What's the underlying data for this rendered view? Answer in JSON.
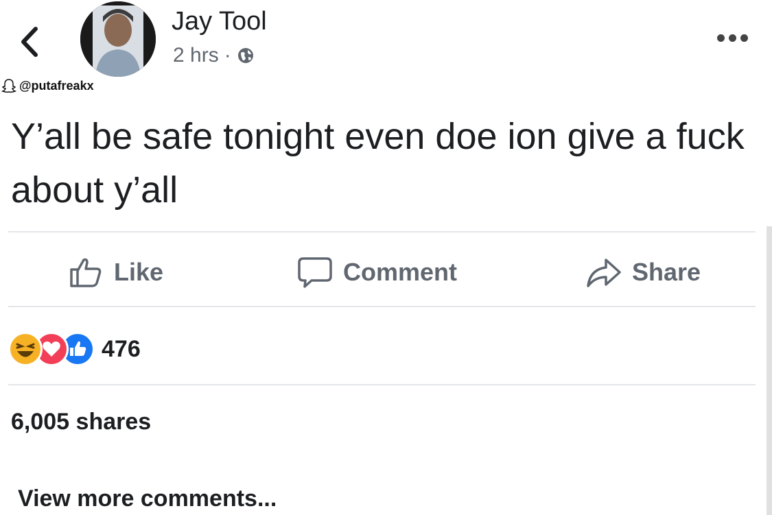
{
  "post": {
    "author": "Jay Tool",
    "time": "2 hrs",
    "separator": "·",
    "privacy_icon": "globe-icon",
    "text": "Y’all be safe tonight even doe ion give a fuck about y’all"
  },
  "watermark": {
    "handle": "@putafreakx",
    "icon": "snapchat-ghost-icon"
  },
  "actions": {
    "like": "Like",
    "comment": "Comment",
    "share": "Share"
  },
  "reactions": {
    "types": [
      "haha",
      "love",
      "like"
    ],
    "count": "476"
  },
  "shares": "6,005 shares",
  "comments": {
    "view_more": "View more comments..."
  },
  "colors": {
    "like_blue": "#1877f2",
    "love_red": "#f33e58",
    "haha_yellow": "#f7b125",
    "secondary_text": "#606770"
  }
}
